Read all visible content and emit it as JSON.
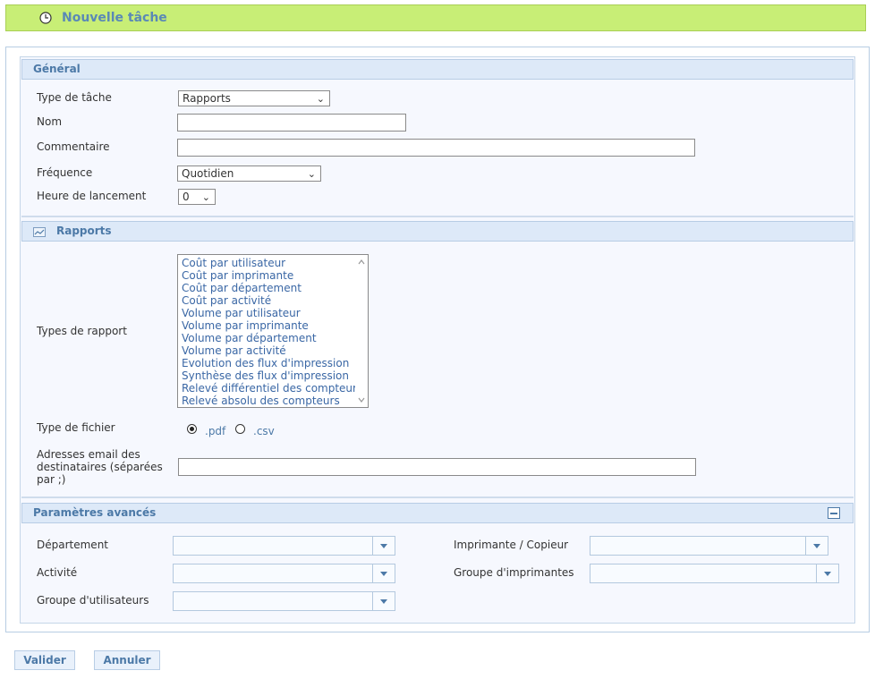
{
  "header": {
    "title": "Nouvelle tâche",
    "icon": "clock-icon"
  },
  "general": {
    "heading": "Général",
    "task_type_label": "Type de tâche",
    "task_type_value": "Rapports",
    "name_label": "Nom",
    "name_value": "",
    "comment_label": "Commentaire",
    "comment_value": "",
    "frequency_label": "Fréquence",
    "frequency_value": "Quotidien",
    "start_hour_label": "Heure de lancement",
    "start_hour_value": "0"
  },
  "reports": {
    "heading": "Rapports",
    "icon": "chart-icon",
    "types_label": "Types de rapport",
    "types": [
      "Coût par utilisateur",
      "Coût par imprimante",
      "Coût par département",
      "Coût par activité",
      "Volume par utilisateur",
      "Volume par imprimante",
      "Volume par département",
      "Volume par activité",
      "Evolution des flux d'impression",
      "Synthèse des flux d'impression",
      "Relevé différentiel des compteurs",
      "Relevé absolu des compteurs"
    ],
    "file_type_label": "Type de fichier",
    "file_types": [
      ".pdf",
      ".csv"
    ],
    "file_type_selected": ".pdf",
    "emails_label": "Adresses email des destinataires (séparées par ;)",
    "emails_value": ""
  },
  "advanced": {
    "heading": "Paramètres avancés",
    "department_label": "Département",
    "activity_label": "Activité",
    "user_group_label": "Groupe d'utilisateurs",
    "printer_label": "Imprimante / Copieur",
    "printer_group_label": "Groupe d'imprimantes"
  },
  "actions": {
    "validate": "Valider",
    "cancel": "Annuler"
  },
  "colors": {
    "title_bar": "#c8ee76",
    "section_head": "#dde9f8",
    "accent": "#4c79a7"
  }
}
